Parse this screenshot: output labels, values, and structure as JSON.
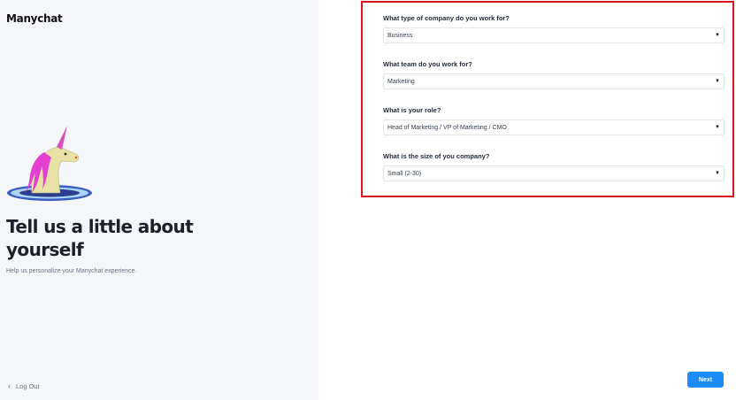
{
  "brand": {
    "name": "Manychat"
  },
  "intro": {
    "headline": "Tell us a little about yourself",
    "subtitle": "Help us personalize your Manychat experience."
  },
  "nav": {
    "logout_label": "Log Out",
    "next_label": "Next"
  },
  "form": {
    "highlight_color": "#e0141e",
    "fields": [
      {
        "question": "What type of company do you work for?",
        "value": "Business"
      },
      {
        "question": "What team do you work for?",
        "value": "Marketing"
      },
      {
        "question": "What is your role?",
        "value": "Head of Marketing / VP of Marketing / CMO"
      },
      {
        "question": "What is the size of you company?",
        "value": "Small (2-30)"
      }
    ]
  },
  "colors": {
    "accent": "#1d8cf8",
    "panel_bg": "#f4f6f9"
  },
  "icons": [
    "unicorn-mascot",
    "chevron-left-icon",
    "dropdown-caret-icon"
  ]
}
